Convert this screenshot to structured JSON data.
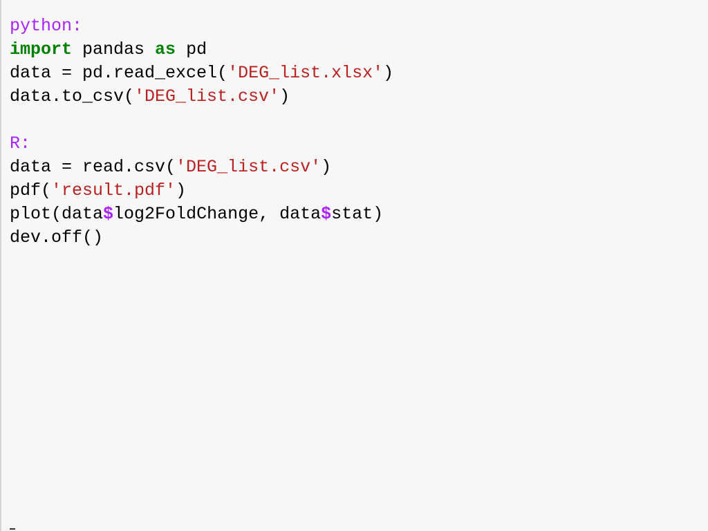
{
  "editor": {
    "lines": [
      {
        "tokens": [
          {
            "text": "python:",
            "kind": "label"
          }
        ]
      },
      {
        "tokens": [
          {
            "text": "import",
            "kind": "kw"
          },
          {
            "text": " pandas ",
            "kind": "plain"
          },
          {
            "text": "as",
            "kind": "kw"
          },
          {
            "text": " pd",
            "kind": "plain"
          }
        ]
      },
      {
        "tokens": [
          {
            "text": "data = pd.read_excel(",
            "kind": "plain"
          },
          {
            "text": "'DEG_list.xlsx'",
            "kind": "str"
          },
          {
            "text": ")",
            "kind": "plain"
          }
        ]
      },
      {
        "tokens": [
          {
            "text": "data.to_csv(",
            "kind": "plain"
          },
          {
            "text": "'DEG_list.csv'",
            "kind": "str"
          },
          {
            "text": ")",
            "kind": "plain"
          }
        ]
      },
      {
        "tokens": []
      },
      {
        "tokens": [
          {
            "text": "R:",
            "kind": "label"
          }
        ]
      },
      {
        "tokens": [
          {
            "text": "data = read.csv(",
            "kind": "plain"
          },
          {
            "text": "'DEG_list.csv'",
            "kind": "str"
          },
          {
            "text": ")",
            "kind": "plain"
          }
        ]
      },
      {
        "tokens": [
          {
            "text": "pdf(",
            "kind": "plain"
          },
          {
            "text": "'result.pdf'",
            "kind": "str"
          },
          {
            "text": ")",
            "kind": "plain"
          }
        ]
      },
      {
        "tokens": [
          {
            "text": "plot(data",
            "kind": "plain"
          },
          {
            "text": "$",
            "kind": "op"
          },
          {
            "text": "log2FoldChange, data",
            "kind": "plain"
          },
          {
            "text": "$",
            "kind": "op"
          },
          {
            "text": "stat)",
            "kind": "plain"
          }
        ]
      },
      {
        "tokens": [
          {
            "text": "dev.off()",
            "kind": "plain"
          }
        ]
      }
    ]
  },
  "colors": {
    "background": "#f7f7f7",
    "label": "#aa22ff",
    "keyword": "#008000",
    "string": "#ba2121",
    "text": "#000000"
  }
}
